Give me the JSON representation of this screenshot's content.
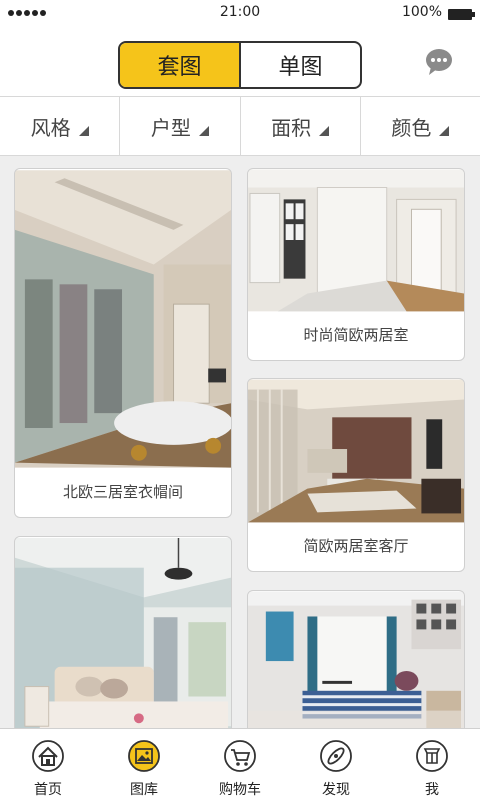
{
  "status_bar": {
    "time": "21:00",
    "battery": "100%"
  },
  "header": {
    "segments": [
      {
        "label": "套图",
        "active": true
      },
      {
        "label": "单图",
        "active": false
      }
    ],
    "accent_color": "#f5c41a"
  },
  "filters": [
    {
      "label": "风格"
    },
    {
      "label": "户型"
    },
    {
      "label": "面积"
    },
    {
      "label": "颜色"
    }
  ],
  "cards": [
    {
      "caption": "北欧三居室衣帽间",
      "image": "walk-in-closet-photo"
    },
    {
      "caption": "时尚简欧两居室",
      "image": "hallway-photo"
    },
    {
      "caption": "简欧两居室客厅",
      "image": "living-room-photo"
    },
    {
      "caption": "",
      "image": "bedroom-photo"
    },
    {
      "caption": "",
      "image": "blue-bedroom-photo"
    }
  ],
  "tabs": [
    {
      "label": "首页",
      "icon": "home-icon"
    },
    {
      "label": "图库",
      "icon": "gallery-icon",
      "active": true
    },
    {
      "label": "购物车",
      "icon": "cart-icon"
    },
    {
      "label": "发现",
      "icon": "compass-icon"
    },
    {
      "label": "我",
      "icon": "user-icon"
    }
  ]
}
